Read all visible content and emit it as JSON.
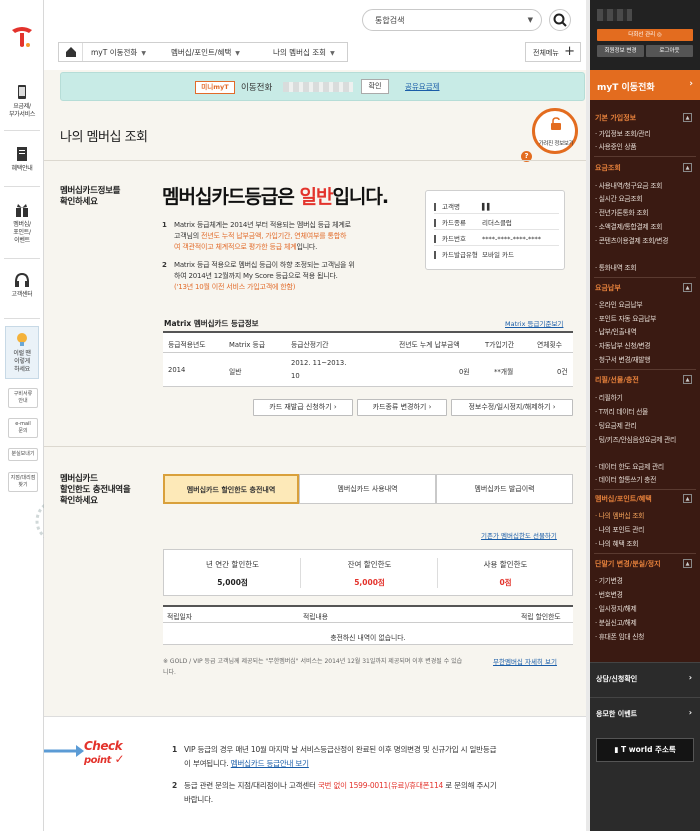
{
  "left_nav": {
    "items": [
      {
        "label": "요금제/\n부가서비스",
        "icon": "phone-icon"
      },
      {
        "label": "혜택안내",
        "icon": "document-icon"
      },
      {
        "label": "멤버십/\n포인트/\n이벤트",
        "icon": "gift-icon"
      },
      {
        "label": "고객센터",
        "icon": "headset-icon"
      },
      {
        "label": "이럴 땐\n이렇게\n하세요",
        "icon": "bulb-icon"
      }
    ],
    "small_buttons": [
      "구비서류\n안내",
      "e-mail\n문의",
      "분실보내기",
      "지점/대리점\n찾기"
    ]
  },
  "header": {
    "search_placeholder": "통합검색",
    "breadcrumb": [
      "myT 이동전화",
      "멤버십/포인트/혜택",
      "나의 멤버십 조회"
    ],
    "all_menu": "전체메뉴"
  },
  "myt_bar": {
    "mini_label": "미니myT",
    "service": "이동전화",
    "confirm": "확인",
    "share_link": "공유요금제"
  },
  "page": {
    "title": "나의 멤버십 조회",
    "privacy_toggle": "가려진 정보보기"
  },
  "membership": {
    "section_label_1": "멤버십카드정보를",
    "section_label_2": "확인하세요",
    "grade_prefix": "멤버십카드등급은",
    "grade": "일반",
    "grade_suffix": "입니다.",
    "para1_a": "Matrix 등급체계는 2014년 부터 적용되는 멤버십 등급 체계로",
    "para1_b": "고객님의",
    "para1_c": "전년도 누적 납부금액, 가입기간, 연체여부를 통합하",
    "para1_d": "여 객관적이고 체계적으로 평가한 등급 체계",
    "para1_e": "입니다.",
    "para2_a": "Matrix 등급 적용으로 멤버십 등급이 하향 조정되는 고객님을 위",
    "para2_b": "하여 2014년 12월까지 My Score 등급으로 적용 됩니다.",
    "para2_c": "('13년 10월 이전 서비스 가입고객에 한함)",
    "info": [
      {
        "key": "고객명",
        "value": "▌▌"
      },
      {
        "key": "카드종류",
        "value": "리더스클럽"
      },
      {
        "key": "카드번호",
        "value": "****-****-****-****"
      },
      {
        "key": "카드발급유형",
        "value": "모바일 카드"
      }
    ]
  },
  "matrix_table": {
    "title": "Matrix 멤버십카드 등급정보",
    "link": "Matrix 등급기준보기",
    "headers": [
      "등급적용년도",
      "Matrix 등급",
      "등급산정기간",
      "전년도 누계 납부금액",
      "T가입기간",
      "연체횟수"
    ],
    "row": [
      "2014",
      "일반",
      "2012. 11~2013.",
      "10",
      "0원",
      "**개월",
      "0건"
    ]
  },
  "actions": [
    "카드 재발급 신청하기",
    "카드종류 변경하기",
    "정보수정/일시정지/해제하기"
  ],
  "discount": {
    "section_label_1": "멤버십카드",
    "section_label_2": "할인한도 충전내역을",
    "section_label_3": "확인하세요",
    "tabs": [
      "멤버십카드 할인한도 충전내역",
      "멤버십카드 사용내역",
      "멤버십카드 발급이력"
    ],
    "charge_link": "기존가 멤버십한도 선물하기",
    "summary": [
      {
        "label": "년 연간 할인한도",
        "value": "5,000점"
      },
      {
        "label": "잔여 할인한도",
        "value": "5,000점"
      },
      {
        "label": "사용 할인한도",
        "value": "0점"
      }
    ],
    "history_headers": [
      "적립일자",
      "적립내용",
      "적립 할인한도"
    ],
    "empty": "충전하신 내역이 없습니다.",
    "note": "※ GOLD / VIP 등급 고객님께 제공되는 \"무한멤버십\" 서비스는 2014년 12월 31일까지 제공되며 이후 변경될 수 있습니다.",
    "note_link": "무한멤버십 자세히 보기"
  },
  "check_point": {
    "title_1": "Check",
    "title_2": "point",
    "item1_a": "VIP 등급의 경우 매년 10월 마지막 날 서비스등급산정이 완료된 이후 명의변경 및 신규가입 시 일반등급",
    "item1_b": "이 부여됩니다.",
    "item1_link": "멤버십카드 등급안내 보기",
    "item2_a": "등급 관련 문의는 지점/대리점이나 고객센터",
    "item2_b": "국번 없이 1599-0011(유료)/휴대폰114",
    "item2_c": "로 문의해 주시기",
    "item2_d": "바랍니다."
  },
  "right_panel": {
    "btn_admin": "다회선 관리 ◎",
    "btn_info": "회원정보 변경",
    "btn_logout": "로그아웃",
    "title": "myT 이동전화",
    "sections": [
      {
        "title": "기본 가입정보",
        "items": [
          "가입정보 조회/관리",
          "사용중인 상품"
        ]
      },
      {
        "title": "요금조회",
        "items": [
          "사용내역/청구요금 조회",
          "실시간 요금조회",
          "전년가톤통화 조회",
          "소액결제/통합결제 조회",
          "콘텐츠이용결제 조회/변경",
          "통화내역 조회"
        ]
      },
      {
        "title": "요금납부",
        "items": [
          "온라인 요금납부",
          "포인트 자동 요금납부",
          "납부/인출내역",
          "자동납부 신청/변경",
          "청구서 변경/재발행"
        ]
      },
      {
        "title": "리필/선물/충전",
        "items": [
          "리필하기",
          "T끼리 데이터 선물",
          "팅요금제 관리",
          "팅/키즈/안심음성요금제 관리",
          "데이터 한도 요금제 관리",
          "데이터 할통쓰기 충전"
        ]
      },
      {
        "title": "멤버십/포인트/혜택",
        "items": [
          "나의 멤버십 조회",
          "나의 포인트 관리",
          "나의 혜택 조회"
        ]
      },
      {
        "title": "단말기 변경/분실/정지",
        "items": [
          "기기변경",
          "번호변경",
          "일시정지/해제",
          "분실신고/해제",
          "휴대폰 임대 신청"
        ]
      }
    ],
    "bottom1": "상담/신청확인",
    "bottom2": "응모한 이벤트",
    "tworld": "T world 주소록"
  },
  "colors": {
    "accent": "#e36c1f",
    "sidebar": "#3a1a12",
    "mint": "#c8ebe6",
    "red": "#e3332c",
    "link": "#1a5da8"
  }
}
